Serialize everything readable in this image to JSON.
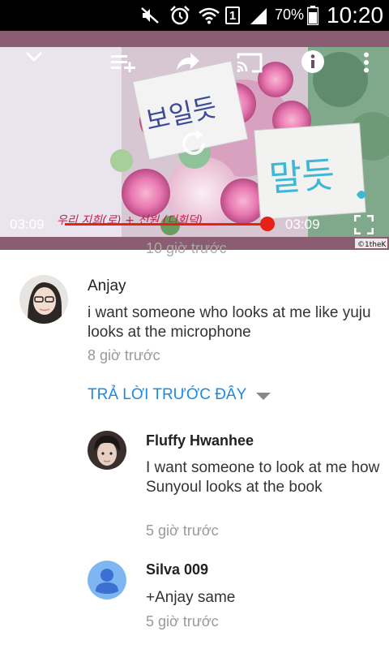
{
  "status_bar": {
    "icons": [
      "mute-icon",
      "alarm-icon",
      "wifi-icon",
      "sim-1-icon",
      "signal-icon",
      "battery-icon"
    ],
    "sim_number": "1",
    "battery_percent": "70%",
    "time": "10:20"
  },
  "player": {
    "controls": [
      "collapse-chevron-icon",
      "add-to-playlist-icon",
      "share-icon",
      "cast-icon",
      "info-icon",
      "more-vert-icon",
      "replay-icon",
      "fullscreen-icon"
    ],
    "elapsed": "03:09",
    "duration": "03:09",
    "progress": 1.0,
    "accent_color": "#e62117",
    "sticky_note_left": "보일듯",
    "sticky_note_right": "말듯",
    "handwritten_caption": "우리 지희(로) + 선원 (디회덕)",
    "watermark": "©1theK"
  },
  "comments": {
    "cut_off_time": "10 giờ trước",
    "main": {
      "author": "Anjay",
      "text": "i want someone who looks at me like yuju looks at the microphone",
      "time": "8 giờ trước"
    },
    "replies_toggle": "TRẢ LỜI TRƯỚC ĐÂY",
    "replies": [
      {
        "author": "Fluffy Hwanhee",
        "text": "I want someone to look at me how Sunyoul looks at the book",
        "time": "5 giờ trước"
      },
      {
        "author": "Silva 009",
        "text": "+Anjay same",
        "time": "5 giờ trước"
      }
    ],
    "link_color": "#1e88e5"
  }
}
